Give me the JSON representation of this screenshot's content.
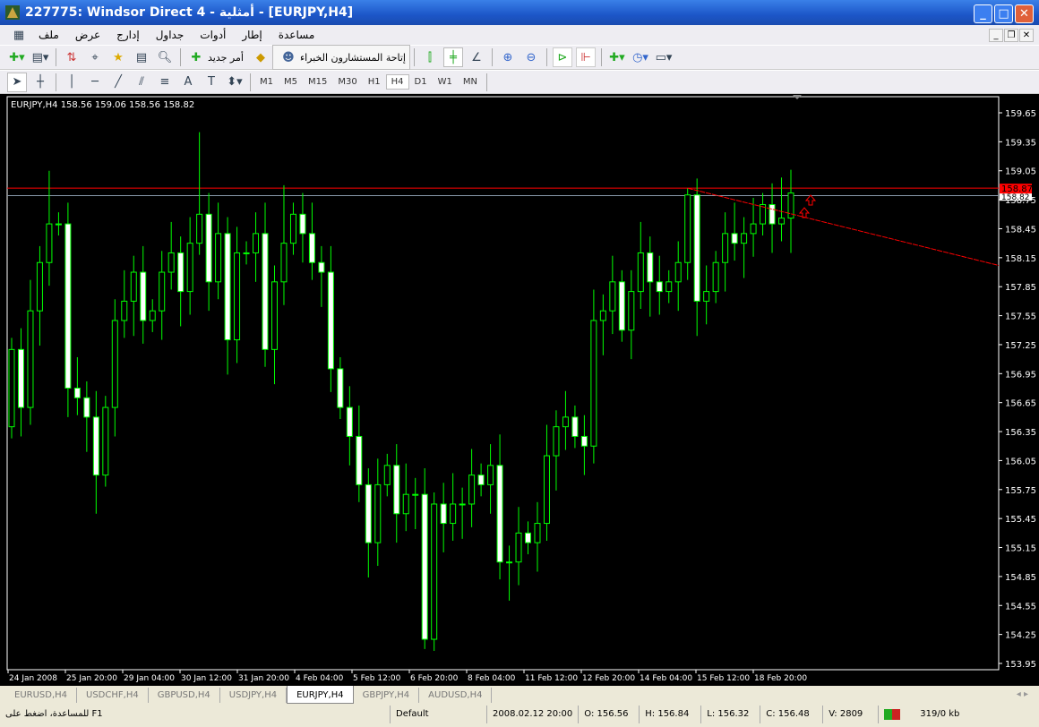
{
  "window": {
    "title": "227775: Windsor Direct 4 - أمثلية - [EURJPY,H4]"
  },
  "menu": [
    "ملف",
    "عرض",
    "إدارج",
    "جداول",
    "أدوات",
    "إطار",
    "مساعدة"
  ],
  "toolbar": {
    "new_order": "أمر جديد",
    "experts": "إتاحة المستشارون الخبراء"
  },
  "timeframes": [
    "M1",
    "M5",
    "M15",
    "M30",
    "H1",
    "H4",
    "D1",
    "W1",
    "MN"
  ],
  "active_timeframe": "H4",
  "tabs": [
    "EURUSD,H4",
    "USDCHF,H4",
    "GBPUSD,H4",
    "USDJPY,H4",
    "EURJPY,H4",
    "GBPJPY,H4",
    "AUDUSD,H4"
  ],
  "active_tab": "EURJPY,H4",
  "status": {
    "help": "للمساعدة، اضغط على F1",
    "profile": "Default",
    "datetime": "2008.02.12 20:00",
    "open": "O: 156.56",
    "high": "H: 156.84",
    "low": "L: 156.32",
    "close": "C: 156.48",
    "volume": "V: 2809",
    "traffic": "319/0 kb"
  },
  "chart_data": {
    "type": "candlestick",
    "title": "EURJPY,H4  158.56 159.06 158.56 158.82",
    "symbol": "EURJPY,H4",
    "ylim": [
      153.95,
      159.65
    ],
    "y_ticks": [
      "159.65",
      "159.35",
      "159.05",
      "158.75",
      "158.45",
      "158.15",
      "157.85",
      "157.55",
      "157.25",
      "156.95",
      "156.65",
      "156.35",
      "156.05",
      "155.75",
      "155.45",
      "155.15",
      "154.85",
      "154.55",
      "154.25",
      "153.95"
    ],
    "x_ticks": [
      "24 Jan 2008",
      "25 Jan 20:00",
      "29 Jan 04:00",
      "30 Jan 12:00",
      "31 Jan 20:00",
      "4 Feb 04:00",
      "5 Feb 12:00",
      "6 Feb 20:00",
      "8 Feb 04:00",
      "11 Feb 12:00",
      "12 Feb 20:00",
      "14 Feb 04:00",
      "15 Feb 12:00",
      "18 Feb 20:00"
    ],
    "first_open": 156.4,
    "closes": [
      157.2,
      156.6,
      157.6,
      158.1,
      158.5,
      158.5,
      156.8,
      156.7,
      156.5,
      155.9,
      156.6,
      157.5,
      157.7,
      158.0,
      157.5,
      157.6,
      158.0,
      158.2,
      157.8,
      158.3,
      158.6,
      157.9,
      158.4,
      157.3,
      158.2,
      158.2,
      158.4,
      157.2,
      157.9,
      158.3,
      158.6,
      158.4,
      158.1,
      158.0,
      157.0,
      156.6,
      156.3,
      155.8,
      155.2,
      155.8,
      156.0,
      155.5,
      155.7,
      155.7,
      154.2,
      155.6,
      155.4,
      155.6,
      155.6,
      155.9,
      155.8,
      156.0,
      155.0,
      155.0,
      155.3,
      155.2,
      155.4,
      156.1,
      156.4,
      156.5,
      156.3,
      156.2,
      157.5,
      157.6,
      157.9,
      157.4,
      157.8,
      158.2,
      157.9,
      157.8,
      157.9,
      158.1,
      158.8,
      157.7,
      157.8,
      158.1,
      158.4,
      158.3,
      158.4,
      158.5,
      158.7,
      158.5,
      158.56,
      158.82
    ],
    "extreme_highs": {
      "4": 159.05,
      "20": 159.45,
      "29": 158.9,
      "72": 158.87,
      "82": 158.98,
      "83": 159.06
    },
    "extreme_lows": {
      "9": 155.5,
      "44": 154.1,
      "53": 154.6
    },
    "hline_price": 158.87,
    "bid_price": 158.82,
    "price_label": "158.87",
    "bid_label": "158.82",
    "trendline": {
      "from_index": 72,
      "from_price": 158.87,
      "to_price": 158.07
    },
    "colors": {
      "bull": "#000000",
      "bear": "#ffffff",
      "outline": "#00ff00",
      "hline": "#ff0000",
      "bid": "#8899aa"
    }
  }
}
